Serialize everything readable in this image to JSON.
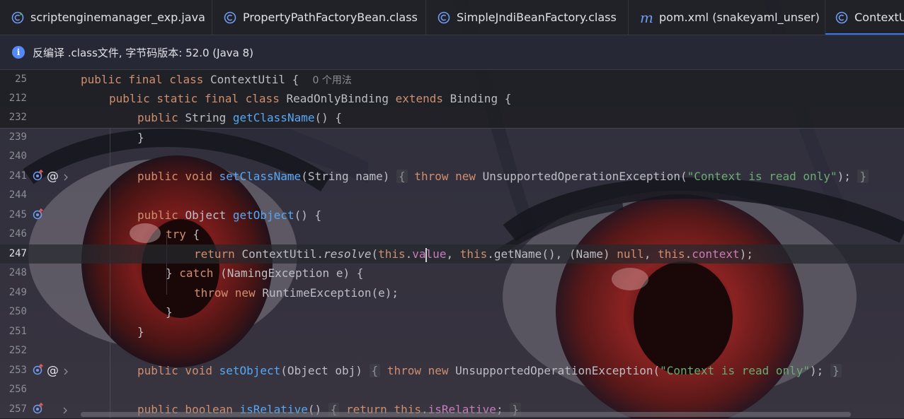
{
  "tabs": [
    {
      "label": "scriptenginemanager_exp.java",
      "icon": "java-class-runnable-icon",
      "active": false
    },
    {
      "label": "PropertyPathFactoryBean.class",
      "icon": "class-icon",
      "active": false
    },
    {
      "label": "SimpleJndiBeanFactory.class",
      "icon": "class-icon",
      "active": false
    },
    {
      "label": "pom.xml (snakeyaml_unser)",
      "icon": "maven-icon",
      "active": false
    },
    {
      "label": "ContextU",
      "icon": "class-icon",
      "active": true
    }
  ],
  "banner": {
    "text": "反编译 .class文件, 字节码版本: 52.0 (Java 8)"
  },
  "sticky": [
    {
      "line": "25",
      "k1": "public final class ",
      "name": "ContextUtil",
      "rest": " {",
      "hint": "0 个用法"
    },
    {
      "line": "212",
      "k1": "public static final class ",
      "name": "ReadOnlyBinding ",
      "k2": "extends ",
      "rest": "Binding {"
    },
    {
      "line": "232",
      "k1": "public ",
      "type": "String ",
      "name": "getClassName",
      "rest": "() {"
    }
  ],
  "lines": {
    "l239": {
      "n": "239",
      "t": "}"
    },
    "l240": {
      "n": "240"
    },
    "l241": {
      "n": "241",
      "k": "public void ",
      "fn": "setClassName",
      "args": "(String name) ",
      "ob": "{",
      "thr": "throw new ",
      "exc": "UnsupportedOperationException(",
      "str": "\"Context is read only\"",
      "end": ");",
      "cb": "}"
    },
    "l244": {
      "n": "244"
    },
    "l245": {
      "n": "245",
      "k": "public ",
      "type": "Object ",
      "fn": "getObject",
      "rest": "() {"
    },
    "l246": {
      "n": "246",
      "k": "try ",
      "rest": "{"
    },
    "l247": {
      "n": "247",
      "k": "return ",
      "cls": "ContextUtil.",
      "mi": "resolve",
      "p1": "(",
      "this1": "this",
      "dot1": ".",
      "fld1a": "va",
      "fld1b": "lue",
      "c1": ", ",
      "this2": "this",
      "m2": ".getName(), (Name) ",
      "nul": "null",
      "c2": ", ",
      "this3": "this",
      "dot3": ".",
      "fld3": "context",
      "end": ");"
    },
    "l248": {
      "n": "248",
      "p": "} ",
      "k": "catch ",
      "rest": "(NamingException e) {"
    },
    "l249": {
      "n": "249",
      "k": "throw new ",
      "rest": "RuntimeException(e);"
    },
    "l250": {
      "n": "250",
      "t": "}"
    },
    "l251": {
      "n": "251",
      "t": "}"
    },
    "l252": {
      "n": "252"
    },
    "l253": {
      "n": "253",
      "k": "public void ",
      "fn": "setObject",
      "args": "(Object obj) ",
      "ob": "{",
      "thr": "throw new ",
      "exc": "UnsupportedOperationException(",
      "str": "\"Context is read only\"",
      "end": ");",
      "cb": "}"
    },
    "l256": {
      "n": "256"
    },
    "l257": {
      "n": "257",
      "k": "public boolean ",
      "fn": "isRelative",
      "rest": "() ",
      "ob": "{",
      "ret": " return ",
      "this1": "this",
      "dot": ".",
      "fld": "isRelative",
      "end": ";",
      "cb": "}"
    }
  },
  "colors": {
    "keyword": "#cf8e6d",
    "function": "#56a8f5",
    "string": "#6aab73",
    "field": "#c77dbb",
    "text": "#bcbec4",
    "accent": "#3574f0"
  }
}
